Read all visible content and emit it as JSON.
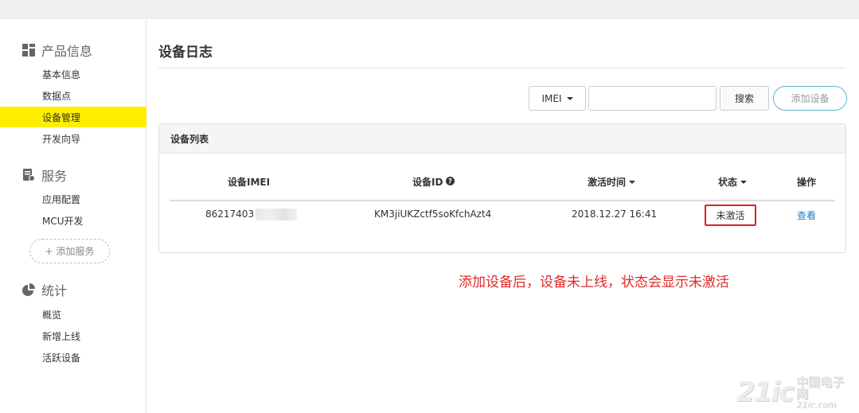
{
  "sidebar": {
    "sections": [
      {
        "title": "产品信息",
        "icon": "grid-icon",
        "items": [
          "基本信息",
          "数据点",
          "设备管理",
          "开发向导"
        ]
      },
      {
        "title": "服务",
        "icon": "service-icon",
        "items": [
          "应用配置",
          "MCU开发"
        ]
      },
      {
        "title": "统计",
        "icon": "pie-chart-icon",
        "items": [
          "概览",
          "新增上线",
          "活跃设备"
        ]
      }
    ],
    "active_item": "设备管理",
    "add_service_label": "+ 添加服务"
  },
  "main": {
    "page_title": "设备日志",
    "toolbar": {
      "filter_select": "IMEI",
      "search_value": "",
      "search_label": "搜索",
      "add_device_label": "添加设备"
    },
    "panel": {
      "title": "设备列表",
      "columns": [
        "设备IMEI",
        "设备ID",
        "激活时间",
        "状态",
        "操作"
      ],
      "rows": [
        {
          "imei": "86217403",
          "device_id": "KM3jiUKZctf5soKfchAzt4",
          "activated_at": "2018.12.27 16:41",
          "status": "未激活",
          "action": "查看"
        }
      ]
    }
  },
  "annotation": "添加设备后，设备未上线，状态会显示未激活",
  "watermark": {
    "brand": "21ic",
    "name": "中国电子网",
    "sub": "21ic.com"
  },
  "colors": {
    "active_bg": "#ffee00",
    "annotation": "#e02a2a",
    "status_highlight": "#e02020",
    "link": "#1f7dc5",
    "add_button_border": "#5cb3d6"
  }
}
